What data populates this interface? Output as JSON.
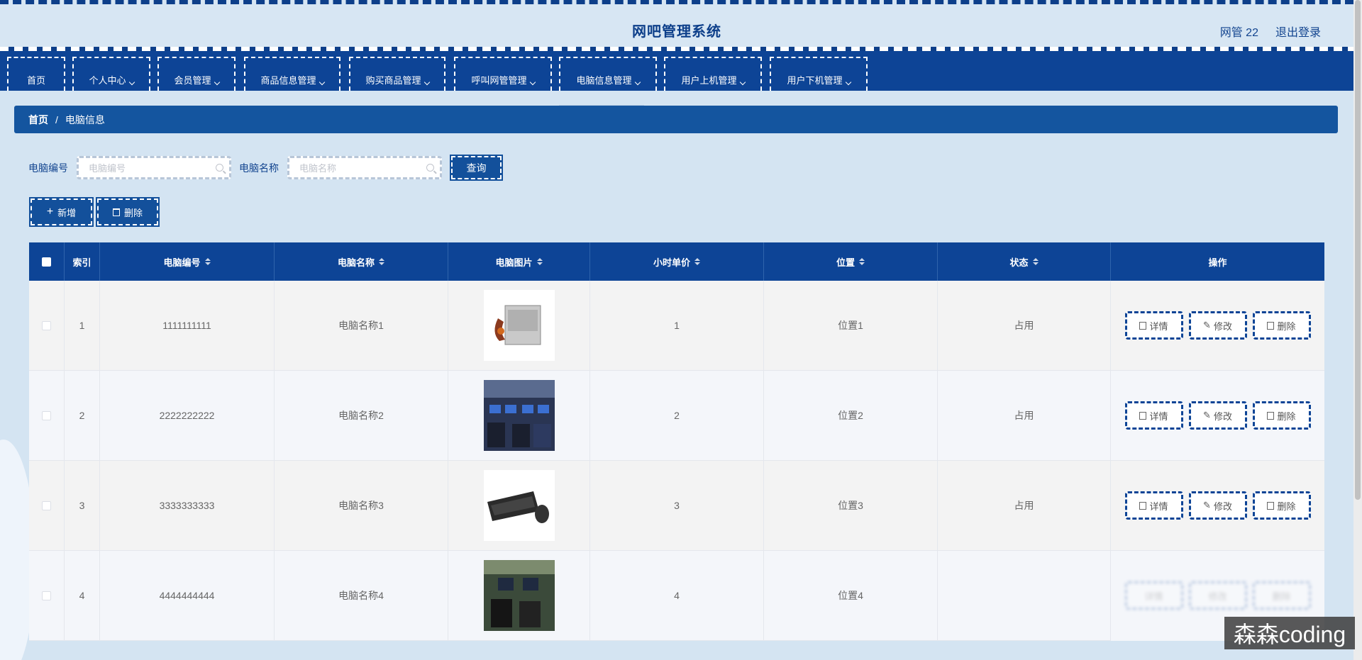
{
  "app": {
    "title": "网吧管理系统",
    "user": "网管 22",
    "logout": "退出登录"
  },
  "nav": [
    {
      "label": "首页",
      "has_menu": false
    },
    {
      "label": "个人中心",
      "has_menu": true
    },
    {
      "label": "会员管理",
      "has_menu": true
    },
    {
      "label": "商品信息管理",
      "has_menu": true
    },
    {
      "label": "购买商品管理",
      "has_menu": true
    },
    {
      "label": "呼叫网管管理",
      "has_menu": true
    },
    {
      "label": "电脑信息管理",
      "has_menu": true
    },
    {
      "label": "用户上机管理",
      "has_menu": true
    },
    {
      "label": "用户下机管理",
      "has_menu": true
    }
  ],
  "breadcrumb": {
    "home": "首页",
    "separator": "/",
    "current": "电脑信息"
  },
  "search": {
    "field1_label": "电脑编号",
    "field1_placeholder": "电脑编号",
    "field2_label": "电脑名称",
    "field2_placeholder": "电脑名称",
    "query_button": "查询"
  },
  "actions": {
    "add": "新增",
    "delete": "删除"
  },
  "table": {
    "columns": [
      "索引",
      "电脑编号",
      "电脑名称",
      "电脑图片",
      "小时单价",
      "位置",
      "状态",
      "操作"
    ],
    "rows": [
      {
        "index": "1",
        "code": "1111111111",
        "name": "电脑名称1",
        "image": "power-supply",
        "price": "1",
        "location": "位置1",
        "status": "占用"
      },
      {
        "index": "2",
        "code": "2222222222",
        "name": "电脑名称2",
        "image": "internet-cafe",
        "price": "2",
        "location": "位置2",
        "status": "占用"
      },
      {
        "index": "3",
        "code": "3333333333",
        "name": "电脑名称3",
        "image": "keyboard-mouse",
        "price": "3",
        "location": "位置3",
        "status": "占用"
      },
      {
        "index": "4",
        "code": "4444444444",
        "name": "电脑名称4",
        "image": "internet-cafe-seats",
        "price": "4",
        "location": "位置4",
        "status": ""
      }
    ],
    "row_buttons": {
      "detail": "详情",
      "edit": "修改",
      "delete": "删除"
    }
  },
  "watermark": "森森coding",
  "colors": {
    "primary": "#0d4496",
    "header_bg": "#d7e6f3",
    "breadcrumb": "#14559f",
    "page_bg": "#d4e4f2"
  }
}
